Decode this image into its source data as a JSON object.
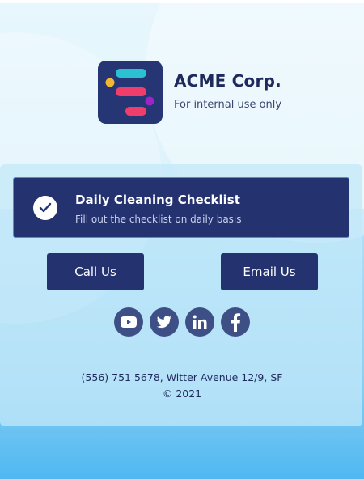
{
  "brand": {
    "name": "ACME Corp.",
    "tagline": "For internal use only"
  },
  "checklist": {
    "title": "Daily Cleaning Checklist",
    "subtitle": "Fill out the checklist on daily basis"
  },
  "buttons": {
    "call": "Call Us",
    "email": "Email Us"
  },
  "social": [
    {
      "icon": "youtube-icon"
    },
    {
      "icon": "twitter-icon"
    },
    {
      "icon": "linkedin-icon"
    },
    {
      "icon": "facebook-icon"
    }
  ],
  "footer": {
    "contact": "(556) 751 5678, Witter Avenue 12/9, SF",
    "copyright": "© 2021"
  },
  "colors": {
    "primary": "#24336f",
    "logo_bg": "#263574",
    "text_dark": "#1e2a5c",
    "bar_teal": "#2bc1d0",
    "bar_pink": "#ef3e6b",
    "dot_yellow": "#f5b731",
    "dot_purple": "#9b25c6"
  }
}
